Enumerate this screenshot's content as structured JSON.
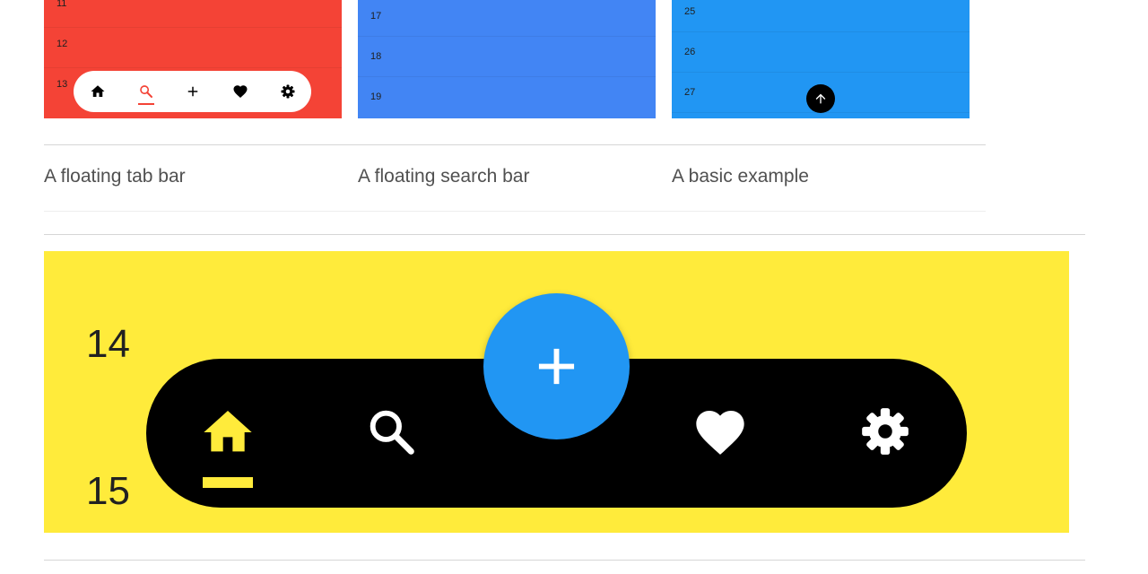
{
  "cards": [
    {
      "caption": "A floating tab bar",
      "color": "#f44336",
      "rows": [
        "11",
        "12",
        "13"
      ],
      "tab_icons": [
        "home-icon",
        "search-icon",
        "plus-icon",
        "heart-icon",
        "gear-icon"
      ],
      "active_tab": "search",
      "accent": "#f44336"
    },
    {
      "caption": "A floating search bar",
      "color": "#4285f4",
      "rows": [
        "17",
        "18",
        "19"
      ]
    },
    {
      "caption": "A basic example",
      "color": "#2196f3",
      "rows": [
        "25",
        "26",
        "27"
      ],
      "fab_icon": "arrow-up-icon"
    }
  ],
  "featured": {
    "color": "#ffeb3b",
    "rows": [
      "14",
      "15"
    ],
    "tab_icons": [
      "home-icon",
      "search-icon",
      "plus-icon",
      "heart-icon",
      "gear-icon"
    ],
    "active_tab": "home",
    "accent": "#ffeb3b",
    "fab_color": "#2196f3"
  }
}
